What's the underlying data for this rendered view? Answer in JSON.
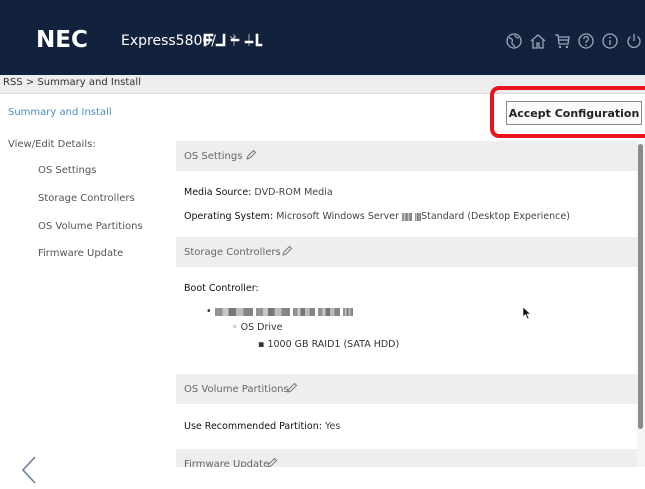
{
  "header": {
    "brand": "NEC",
    "product": "Express5800/",
    "model_glyph": "model-logo-glyph",
    "icons": [
      "globe-icon",
      "home-icon",
      "cart-icon",
      "help-icon",
      "info-icon",
      "power-icon"
    ]
  },
  "breadcrumb": "RSS > Summary and Install",
  "sidebar": {
    "active": "Summary and Install",
    "group_label": "View/Edit Details:",
    "items": [
      "OS Settings",
      "Storage Controllers",
      "OS Volume Partitions",
      "Firmware Update"
    ]
  },
  "actions": {
    "accept": "Accept Configuration"
  },
  "sections": {
    "os_settings": {
      "title": "OS Settings",
      "media_label": "Media Source:",
      "media_value": "DVD-ROM Media",
      "os_label": "Operating System:",
      "os_value_prefix": "Microsoft Windows Server",
      "os_value_suffix": "Standard (Desktop Experience)"
    },
    "storage": {
      "title": "Storage Controllers",
      "boot_label": "Boot Controller:",
      "drive_label": "OS Drive",
      "drive_value": "1000 GB RAID1 (SATA HDD)"
    },
    "partitions": {
      "title": "OS Volume Partitions",
      "partition_label": "Use Recommended Partition:",
      "partition_value": "Yes"
    },
    "firmware": {
      "title": "Firmware Update"
    }
  },
  "colors": {
    "header_bg": "#13223c",
    "active_link": "#4a8cc4",
    "highlight_border": "#e8131b"
  }
}
